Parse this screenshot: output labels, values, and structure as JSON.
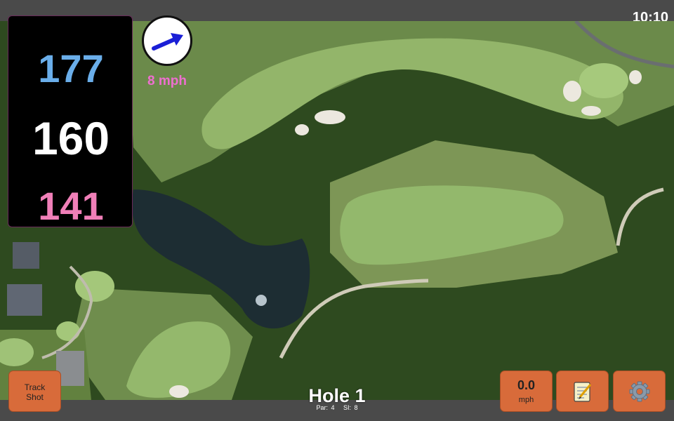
{
  "clock": "10:10",
  "yardages": {
    "back": "177",
    "center": "160",
    "front": "141"
  },
  "wind": {
    "speed_label": "8 mph",
    "arrow_icon": "wind-arrow-icon"
  },
  "hole": {
    "title": "Hole 1",
    "par": "Par: 4",
    "si": "SI: 8"
  },
  "buttons": {
    "track_shot": [
      "Track",
      "Shot"
    ],
    "wind_speed_value": "0.0",
    "wind_speed_unit": "mph",
    "notes_icon": "notepad-icon",
    "settings_icon": "gear-icon"
  },
  "colors": {
    "back": "#6aaeea",
    "center": "#ffffff",
    "front": "#f07fb8",
    "wind_label": "#ee6fd0",
    "button": "#d86b3a"
  }
}
